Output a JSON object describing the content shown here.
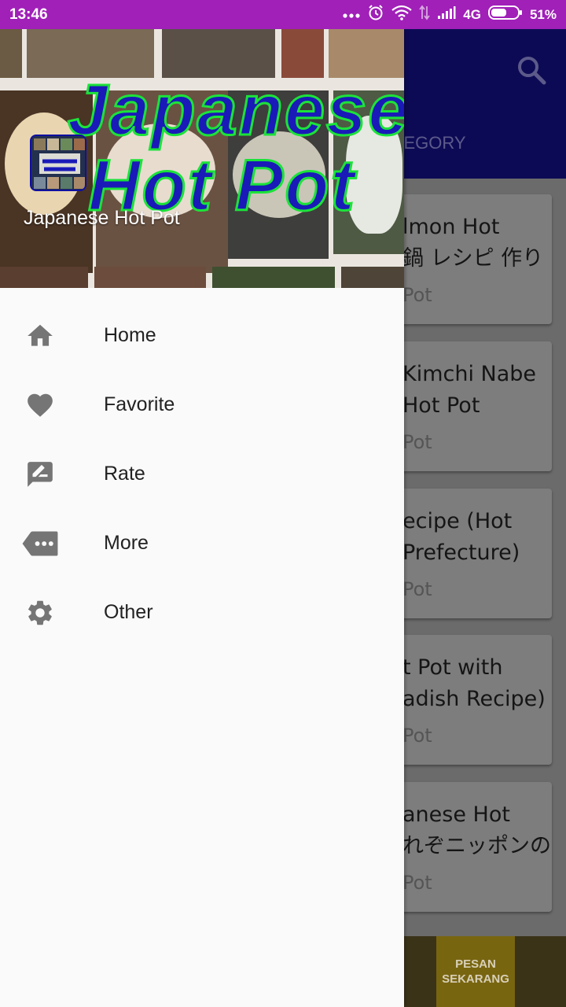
{
  "status_bar": {
    "time": "13:46",
    "signal_type": "4G",
    "battery": "51%"
  },
  "drawer": {
    "header": {
      "title_line1": "Japanese",
      "title_line2": "Hot  Pot",
      "app_name": "Japanese Hot Pot"
    },
    "menu": [
      {
        "label": "Home",
        "icon": "home-icon"
      },
      {
        "label": "Favorite",
        "icon": "heart-icon"
      },
      {
        "label": "Rate",
        "icon": "rate-review-icon"
      },
      {
        "label": "More",
        "icon": "more-tag-icon"
      },
      {
        "label": "Other",
        "icon": "gear-icon"
      }
    ]
  },
  "background_app": {
    "tab_label": "TEGORY",
    "cards": [
      {
        "title_line1": "lmon Hot",
        "title_line2": "鍋 レシピ 作り",
        "category": "Pot"
      },
      {
        "title_line1": "Kimchi Nabe",
        "title_line2": " Hot Pot",
        "category": "Pot"
      },
      {
        "title_line1": "ecipe (Hot",
        "title_line2": " Prefecture)",
        "category": "Pot"
      },
      {
        "title_line1": "t Pot with",
        "title_line2": "adish Recipe)",
        "category": "Pot"
      },
      {
        "title_line1": "anese Hot",
        "title_line2": "れぞニッポンの",
        "category": "Pot"
      }
    ],
    "banner": {
      "line1": "PESAN",
      "line2": "SEKARANG"
    }
  },
  "colors": {
    "status_bar": "#a020b8",
    "app_bar": "#0d0a55",
    "drawer_bg": "#fafafa",
    "icon_gray": "#757575",
    "title_blue": "#1a1ab8",
    "title_outline": "#1ce23a"
  }
}
